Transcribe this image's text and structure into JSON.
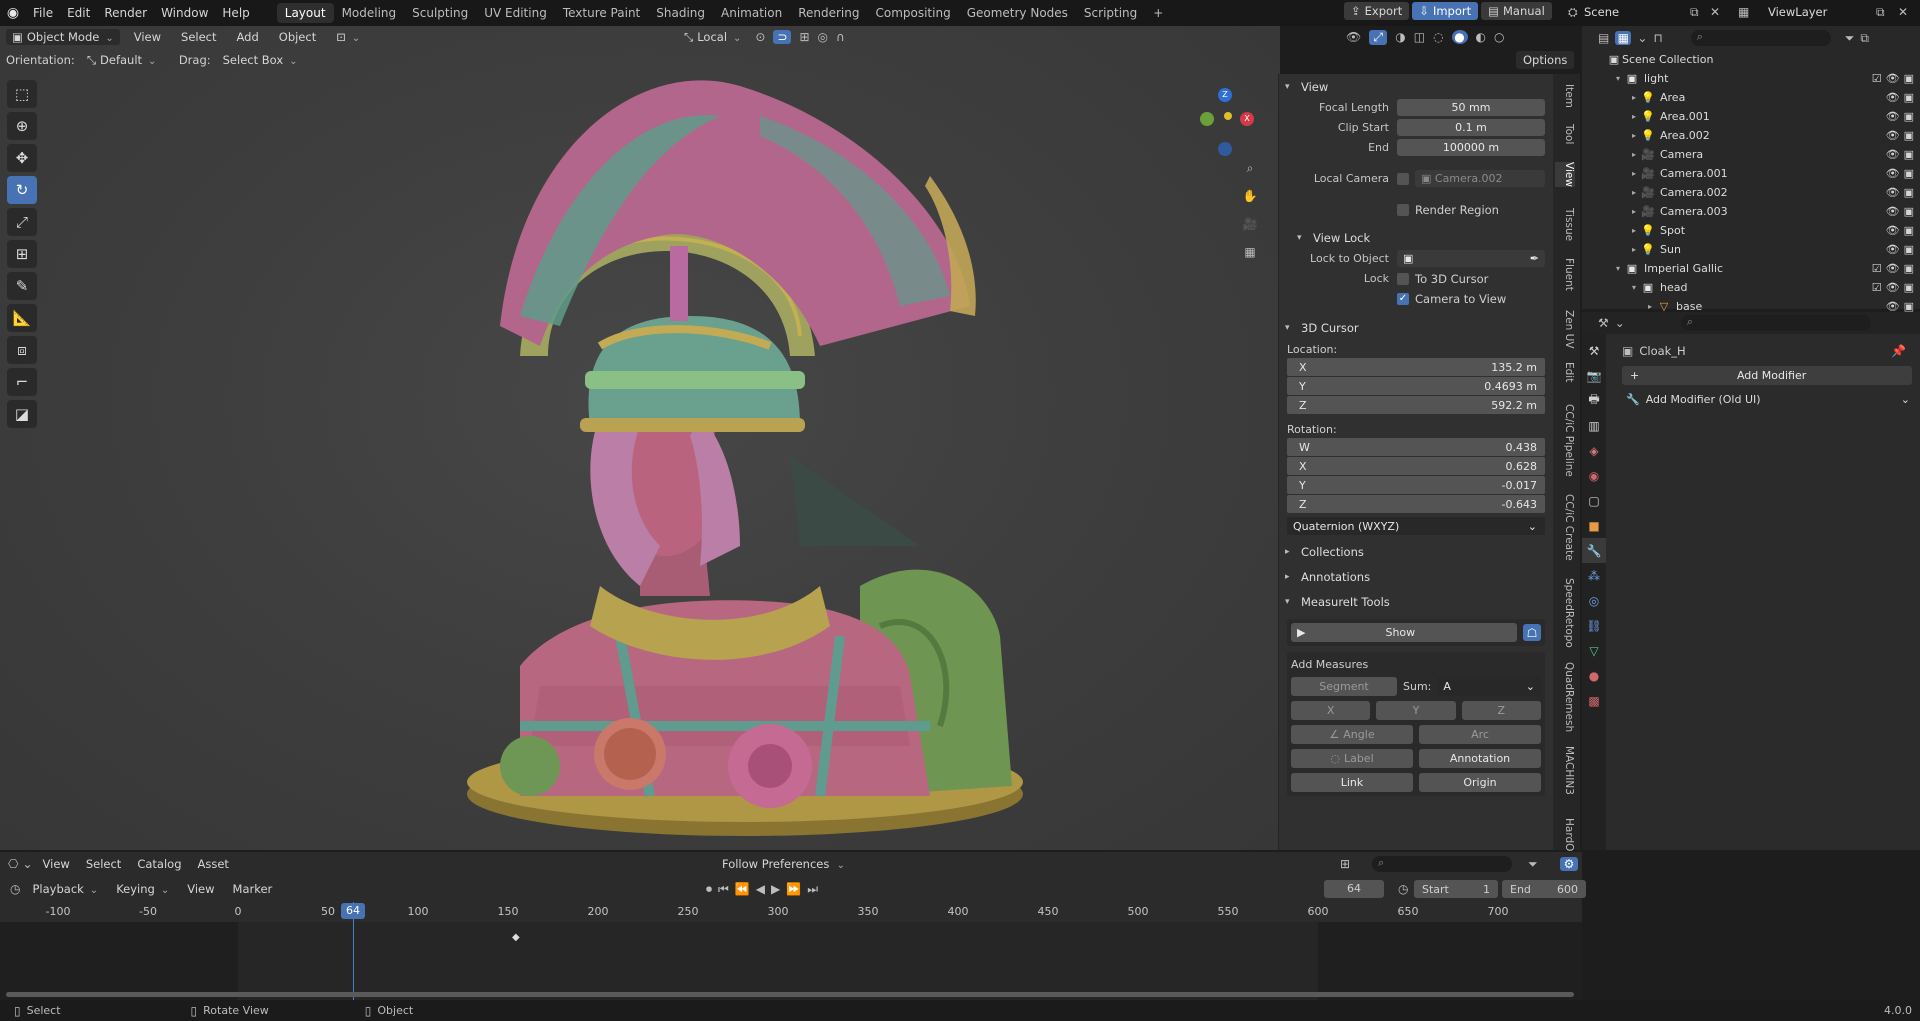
{
  "menu": {
    "items": [
      "File",
      "Edit",
      "Render",
      "Window",
      "Help"
    ]
  },
  "workspaces": [
    "Layout",
    "Modeling",
    "Sculpting",
    "UV Editing",
    "Texture Paint",
    "Shading",
    "Animation",
    "Rendering",
    "Compositing",
    "Geometry Nodes",
    "Scripting"
  ],
  "topright": {
    "export": "Export",
    "import": "Import",
    "manual": "Manual",
    "scene": "Scene",
    "viewlayer": "ViewLayer"
  },
  "viewport": {
    "mode": "Object Mode",
    "menus": [
      "View",
      "Select",
      "Add",
      "Object"
    ],
    "transform": "Local",
    "orientation_label": "Orientation:",
    "orientation": "Default",
    "drag_label": "Drag:",
    "drag": "Select Box",
    "options": "Options"
  },
  "npanel": {
    "view_title": "View",
    "focal_label": "Focal Length",
    "focal": "50 mm",
    "clip_start_label": "Clip Start",
    "clip_start": "0.1 m",
    "end_label": "End",
    "end": "100000 m",
    "local_camera_label": "Local Camera",
    "local_camera": "Camera.002",
    "render_region": "Render Region",
    "view_lock_title": "View Lock",
    "lock_to_object_label": "Lock to Object",
    "lock_label": "Lock",
    "to_3d_cursor": "To 3D Cursor",
    "camera_to_view": "Camera to View",
    "cursor_title": "3D Cursor",
    "location_label": "Location:",
    "loc": [
      {
        "k": "X",
        "v": "135.2 m"
      },
      {
        "k": "Y",
        "v": "0.4693 m"
      },
      {
        "k": "Z",
        "v": "592.2 m"
      }
    ],
    "rotation_label": "Rotation:",
    "rot": [
      {
        "k": "W",
        "v": "0.438"
      },
      {
        "k": "X",
        "v": "0.628"
      },
      {
        "k": "Y",
        "v": "-0.017"
      },
      {
        "k": "Z",
        "v": "-0.643"
      }
    ],
    "rot_mode": "Quaternion (WXYZ)",
    "collections": "Collections",
    "annotations": "Annotations",
    "measureit": "MeasureIt Tools",
    "show": "Show",
    "add_measures": "Add Measures",
    "segment": "Segment",
    "sum_label": "Sum:",
    "sum": "A",
    "x": "X",
    "y": "Y",
    "z": "Z",
    "angle": "Angle",
    "arc": "Arc",
    "label": "Label",
    "annotation": "Annotation",
    "link": "Link",
    "origin": "Origin",
    "tabs": [
      "Item",
      "Tool",
      "View",
      "Tissue",
      "Fluent",
      "Zen UV",
      "Edit",
      "CC/iC Pipeline",
      "CC/iC Create",
      "SpeedRetopo",
      "QuadRemesh",
      "MACHIN3",
      "HardO"
    ]
  },
  "outliner": {
    "root": "Scene Collection",
    "rows": [
      {
        "name": "light",
        "level": 0,
        "icon": "collection"
      },
      {
        "name": "Area",
        "level": 1,
        "icon": "light"
      },
      {
        "name": "Area.001",
        "level": 1,
        "icon": "light"
      },
      {
        "name": "Area.002",
        "level": 1,
        "icon": "light"
      },
      {
        "name": "Camera",
        "level": 1,
        "icon": "camera"
      },
      {
        "name": "Camera.001",
        "level": 1,
        "icon": "camera"
      },
      {
        "name": "Camera.002",
        "level": 1,
        "icon": "camera"
      },
      {
        "name": "Camera.003",
        "level": 1,
        "icon": "camera"
      },
      {
        "name": "Spot",
        "level": 1,
        "icon": "light"
      },
      {
        "name": "Sun",
        "level": 1,
        "icon": "light"
      },
      {
        "name": "Imperial Gallic",
        "level": 0,
        "icon": "collection"
      },
      {
        "name": "head",
        "level": 1,
        "icon": "collection"
      },
      {
        "name": "base",
        "level": 2,
        "icon": "mesh"
      }
    ]
  },
  "properties": {
    "object": "Cloak_H",
    "add_modifier": "Add Modifier",
    "add_modifier_old": "Add Modifier (Old UI)"
  },
  "asset_bar": {
    "menus": [
      "View",
      "Select",
      "Catalog",
      "Asset"
    ],
    "follow": "Follow Preferences"
  },
  "timeline": {
    "menus": [
      "Playback",
      "Keying",
      "View",
      "Marker"
    ],
    "current": "64",
    "start_label": "Start",
    "start": "1",
    "end_label": "End",
    "end": "600",
    "ticks": [
      "-100",
      "-50",
      "0",
      "50",
      "100",
      "150",
      "200",
      "250",
      "300",
      "350",
      "400",
      "450",
      "500",
      "550",
      "600",
      "650",
      "700"
    ]
  },
  "status": {
    "select": "Select",
    "rotate": "Rotate View",
    "object": "Object",
    "version": "4.0.0"
  },
  "colors": {
    "accent": "#4772b3",
    "panel": "#303030",
    "viewport": "#3d3d3d"
  }
}
